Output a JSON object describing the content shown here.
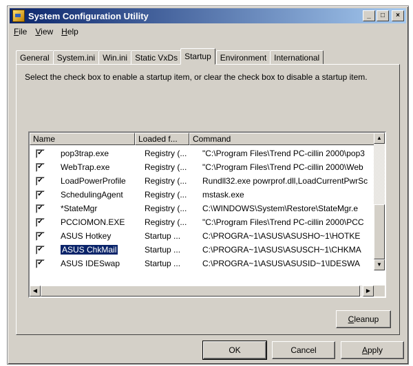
{
  "window": {
    "title": "System Configuration Utility"
  },
  "title_buttons": {
    "minimize": "_",
    "maximize": "□",
    "close": "×"
  },
  "menu": [
    {
      "accel": "F",
      "rest": "ile"
    },
    {
      "accel": "V",
      "rest": "iew"
    },
    {
      "accel": "H",
      "rest": "elp"
    }
  ],
  "tabs": [
    "General",
    "System.ini",
    "Win.ini",
    "Static VxDs",
    "Startup",
    "Environment",
    "International"
  ],
  "active_tab": "Startup",
  "instructions": "Select the check box to enable a startup item, or clear the check box to disable a startup item.",
  "list": {
    "columns": [
      "Name",
      "Loaded f...",
      "Command"
    ],
    "rows": [
      {
        "checked": true,
        "name": "pop3trap.exe",
        "loaded": "Registry (...",
        "command": "\"C:\\Program Files\\Trend PC-cillin 2000\\pop3"
      },
      {
        "checked": true,
        "name": "WebTrap.exe",
        "loaded": "Registry (...",
        "command": "\"C:\\Program Files\\Trend PC-cillin 2000\\Web"
      },
      {
        "checked": true,
        "name": "LoadPowerProfile",
        "loaded": "Registry (...",
        "command": "Rundll32.exe powrprof.dll,LoadCurrentPwrSc"
      },
      {
        "checked": true,
        "name": "SchedulingAgent",
        "loaded": "Registry (...",
        "command": "mstask.exe"
      },
      {
        "checked": true,
        "name": "*StateMgr",
        "loaded": "Registry (...",
        "command": "C:\\WINDOWS\\System\\Restore\\StateMgr.e"
      },
      {
        "checked": true,
        "name": "PCCIOMON.EXE",
        "loaded": "Registry (...",
        "command": "\"C:\\Program Files\\Trend PC-cillin 2000\\PCC"
      },
      {
        "checked": true,
        "name": "ASUS Hotkey",
        "loaded": "Startup ...",
        "command": "C:\\PROGRA~1\\ASUS\\ASUSHO~1\\HOTKE"
      },
      {
        "checked": true,
        "name": "ASUS ChkMail",
        "loaded": "Startup ...",
        "command": "C:\\PROGRA~1\\ASUS\\ASUSCH~1\\CHKMA"
      },
      {
        "checked": true,
        "name": "ASUS IDESwap",
        "loaded": "Startup ...",
        "command": "C:\\PROGRA~1\\ASUS\\ASUSID~1\\IDESWA"
      }
    ],
    "selected_index": 7,
    "check_glyph": "✔"
  },
  "scroll": {
    "up": "▲",
    "down": "▼",
    "left": "◀",
    "right": "▶"
  },
  "buttons": {
    "cleanup": {
      "accel": "C",
      "rest": "leanup"
    },
    "ok": "OK",
    "cancel": "Cancel",
    "apply": {
      "accel": "A",
      "rest": "pply"
    }
  }
}
